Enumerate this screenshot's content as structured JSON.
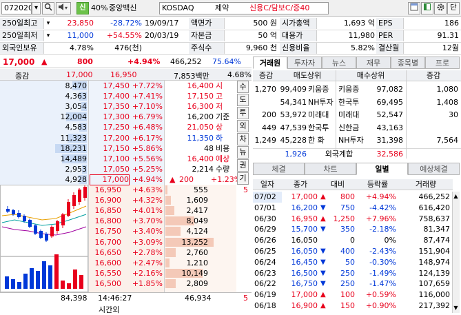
{
  "topbar": {
    "code": "072020",
    "sin": "신",
    "pct": "40%",
    "name": "중앙백신",
    "market": "KOSDAQ",
    "sector": "제약",
    "credit": "신용C/담보C/증40",
    "btn_last": "단"
  },
  "info": [
    {
      "l1": "250일최고",
      "v1": "23,850",
      "c1": "red",
      "v2": "-28.72%",
      "c2": "blue",
      "d": "19/09/17",
      "l2": "액면가",
      "v3": "500 원",
      "l3": "시가총액",
      "v4": "1,693 억",
      "l4": "EPS",
      "v5": "186"
    },
    {
      "l1": "250일최저",
      "v1": "11,000",
      "c1": "blue",
      "v2": "+54.55%",
      "c2": "red",
      "d": "20/03/19",
      "l2": "자본금",
      "v3": "50 억",
      "l3": "대용가",
      "v4": "11,980",
      "l4": "PER",
      "v5": "91.31"
    },
    {
      "l1": "외국인보유",
      "v1": "4.78%",
      "c1": "",
      "v2": "476(천)",
      "c2": "",
      "d": "",
      "l2": "주식수",
      "v3": "9,960 천",
      "l3": "신용비율",
      "v4": "5.82%",
      "l4": "결산월",
      "v5": "12월"
    }
  ],
  "price": {
    "cur": "17,000",
    "arrow": "▲",
    "chg": "800",
    "pct": "+4.94%",
    "vol": "466,252",
    "volpct": "75.64%"
  },
  "head": {
    "lbl": "증감",
    "p1": "17,000",
    "p2": "16,950",
    "amt": "7,853백만",
    "pct": "4.68%"
  },
  "asks": [
    {
      "q": "8,470",
      "p": "17,450",
      "r": "+7.72%",
      "w": 0.35
    },
    {
      "q": "4,363",
      "p": "17,400",
      "r": "+7.41%",
      "w": 0.18
    },
    {
      "q": "3,054",
      "p": "17,350",
      "r": "+7.10%",
      "w": 0.13
    },
    {
      "q": "12,004",
      "p": "17,300",
      "r": "+6.79%",
      "w": 0.5
    },
    {
      "q": "4,583",
      "p": "17,250",
      "r": "+6.48%",
      "w": 0.19
    },
    {
      "q": "11,323",
      "p": "17,200",
      "r": "+6.17%",
      "w": 0.47
    },
    {
      "q": "18,231",
      "p": "17,150",
      "r": "+5.86%",
      "w": 0.76
    },
    {
      "q": "14,489",
      "p": "17,100",
      "r": "+5.56%",
      "w": 0.6
    },
    {
      "q": "2,953",
      "p": "17,050",
      "r": "+5.25%",
      "w": 0.12
    },
    {
      "q": "4,928",
      "p": "17,000",
      "r": "+4.94%",
      "w": 0.2
    }
  ],
  "stats": [
    {
      "v": "16,400",
      "k": "시",
      "c": "red"
    },
    {
      "v": "17,150",
      "k": "고",
      "c": "red"
    },
    {
      "v": "16,300",
      "k": "저",
      "c": "red"
    },
    {
      "v": "16,200",
      "k": "기준",
      "c": ""
    },
    {
      "v": "21,050",
      "k": "상",
      "c": "red"
    },
    {
      "v": "11,350",
      "k": "하",
      "c": "blue"
    },
    {
      "v": "48",
      "k": "비용",
      "c": ""
    },
    {
      "v": "16,400",
      "k": "예상",
      "c": "red"
    },
    {
      "v": "2,214",
      "k": "수량",
      "c": ""
    }
  ],
  "expect": {
    "arrow": "▲",
    "chg": "200",
    "pct": "+1.23%"
  },
  "sidebtns": [
    "수",
    "도",
    "투",
    "외",
    "차",
    "뉴",
    "권",
    "기"
  ],
  "bids": [
    {
      "p": "16,950",
      "r": "+4.63%",
      "q": "555",
      "w": 0.04
    },
    {
      "p": "16,900",
      "r": "+4.32%",
      "q": "1,609",
      "w": 0.12
    },
    {
      "p": "16,850",
      "r": "+4.01%",
      "q": "2,417",
      "w": 0.18
    },
    {
      "p": "16,800",
      "r": "+3.70%",
      "q": "8,049",
      "w": 0.6
    },
    {
      "p": "16,750",
      "r": "+3.40%",
      "q": "4,124",
      "w": 0.31
    },
    {
      "p": "16,700",
      "r": "+3.09%",
      "q": "13,252",
      "w": 1.0
    },
    {
      "p": "16,650",
      "r": "+2.78%",
      "q": "2,760",
      "w": 0.21
    },
    {
      "p": "16,600",
      "r": "+2.47%",
      "q": "1,210",
      "w": 0.09
    },
    {
      "p": "16,550",
      "r": "+2.16%",
      "q": "10,149",
      "w": 0.77
    },
    {
      "p": "16,500",
      "r": "+1.85%",
      "q": "2,809",
      "w": 0.21
    }
  ],
  "side5": "5",
  "foot": {
    "ask": "84,398",
    "time": "14:46:27",
    "bid": "46,934",
    "n": "5",
    "label": "시간외"
  },
  "broker": {
    "tabs": [
      "거래원",
      "투자자",
      "뉴스",
      "재무",
      "종목별",
      "프로"
    ],
    "cols": [
      "증감",
      "매도상위",
      "매수상위",
      "증감"
    ],
    "rows": [
      {
        "sc": "1,270",
        "sq": "99,409",
        "sn": "키움증",
        "bn": "키움증",
        "bq": "97,082",
        "bc": "1,080"
      },
      {
        "sc": "",
        "sq": "54,341",
        "sn": "NH투자",
        "bn": "한국투",
        "bq": "69,495",
        "bc": "1,408"
      },
      {
        "sc": "200",
        "sq": "53,972",
        "sn": "미래대",
        "bn": "미래대",
        "bq": "52,547",
        "bc": "30"
      },
      {
        "sc": "449",
        "sq": "47,539",
        "sn": "한국투",
        "bn": "신한금",
        "bq": "43,163",
        "bc": ""
      },
      {
        "sc": "1,249",
        "sq": "45,228",
        "sn": "한 화",
        "bn": "NH투자",
        "bq": "31,398",
        "bc": "7,564"
      }
    ],
    "foreign": {
      "sell": "1,926",
      "label": "외국계합",
      "buy": "32,586"
    }
  },
  "daily": {
    "tabs": [
      "체결",
      "차트",
      "일별",
      "예상체결"
    ],
    "cols": [
      "일자",
      "종가",
      "대비",
      "등락률",
      "거래량"
    ],
    "rows": [
      {
        "d": "07/02",
        "c": "17,000",
        "a": "▲",
        "v": "800",
        "r": "+4.94%",
        "q": "466,252",
        "s": "up"
      },
      {
        "d": "07/01",
        "c": "16,200",
        "a": "▼",
        "v": "750",
        "r": "-4.42%",
        "q": "616,420",
        "s": "dn"
      },
      {
        "d": "06/30",
        "c": "16,950",
        "a": "▲",
        "v": "1,250",
        "r": "+7.96%",
        "q": "758,637",
        "s": "up"
      },
      {
        "d": "06/29",
        "c": "15,700",
        "a": "▼",
        "v": "350",
        "r": "-2.18%",
        "q": "81,347",
        "s": "dn"
      },
      {
        "d": "06/26",
        "c": "16,050",
        "a": "",
        "v": "0",
        "r": "0%",
        "q": "87,474",
        "s": "fl"
      },
      {
        "d": "06/25",
        "c": "16,050",
        "a": "▼",
        "v": "400",
        "r": "-2.43%",
        "q": "151,904",
        "s": "dn"
      },
      {
        "d": "06/24",
        "c": "16,450",
        "a": "▼",
        "v": "50",
        "r": "-0.30%",
        "q": "148,974",
        "s": "dn"
      },
      {
        "d": "06/23",
        "c": "16,500",
        "a": "▼",
        "v": "250",
        "r": "-1.49%",
        "q": "124,139",
        "s": "dn"
      },
      {
        "d": "06/22",
        "c": "16,750",
        "a": "▼",
        "v": "250",
        "r": "-1.47%",
        "q": "107,659",
        "s": "dn"
      },
      {
        "d": "06/19",
        "c": "17,000",
        "a": "▲",
        "v": "100",
        "r": "+0.59%",
        "q": "116,000",
        "s": "up"
      },
      {
        "d": "06/18",
        "c": "16,900",
        "a": "▲",
        "v": "150",
        "r": "+0.90%",
        "q": "217,392",
        "s": "up"
      }
    ]
  },
  "colors": {
    "red": "#e8001c",
    "blue": "#0038d8",
    "ask_bg": "#eaf1fb",
    "bid_bg": "#fbf0ea",
    "ask_bar": "#c7d9f3",
    "bid_bar": "#f4c9b8"
  }
}
